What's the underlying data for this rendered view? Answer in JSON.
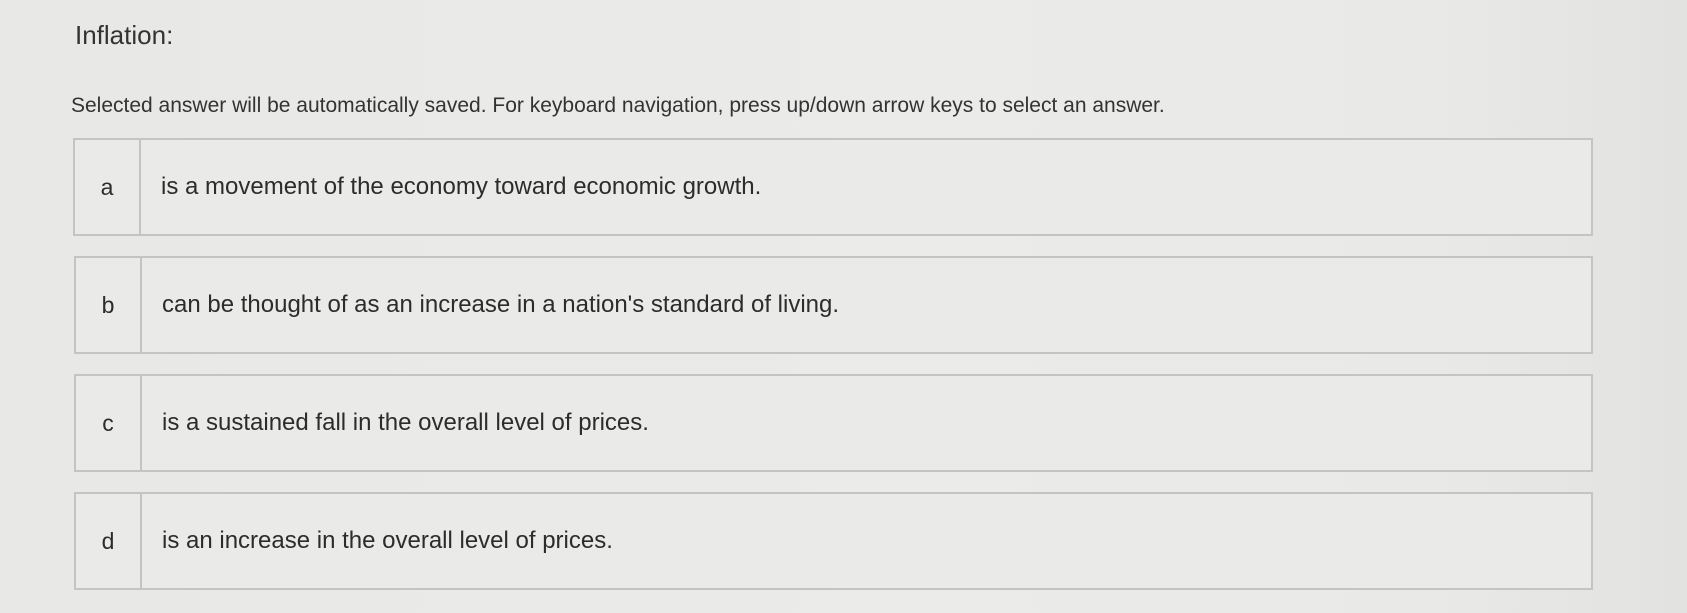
{
  "question": {
    "title": "Inflation:",
    "instructions": "Selected answer will be automatically saved. For keyboard navigation, press up/down arrow keys to select an answer."
  },
  "options": [
    {
      "letter": "a",
      "text": "is a movement of the economy toward economic growth."
    },
    {
      "letter": "b",
      "text": "can be thought of as an increase in a nation's standard of living."
    },
    {
      "letter": "c",
      "text": "is a sustained fall in the overall level of prices."
    },
    {
      "letter": "d",
      "text": "is an increase in the overall level of prices."
    }
  ]
}
